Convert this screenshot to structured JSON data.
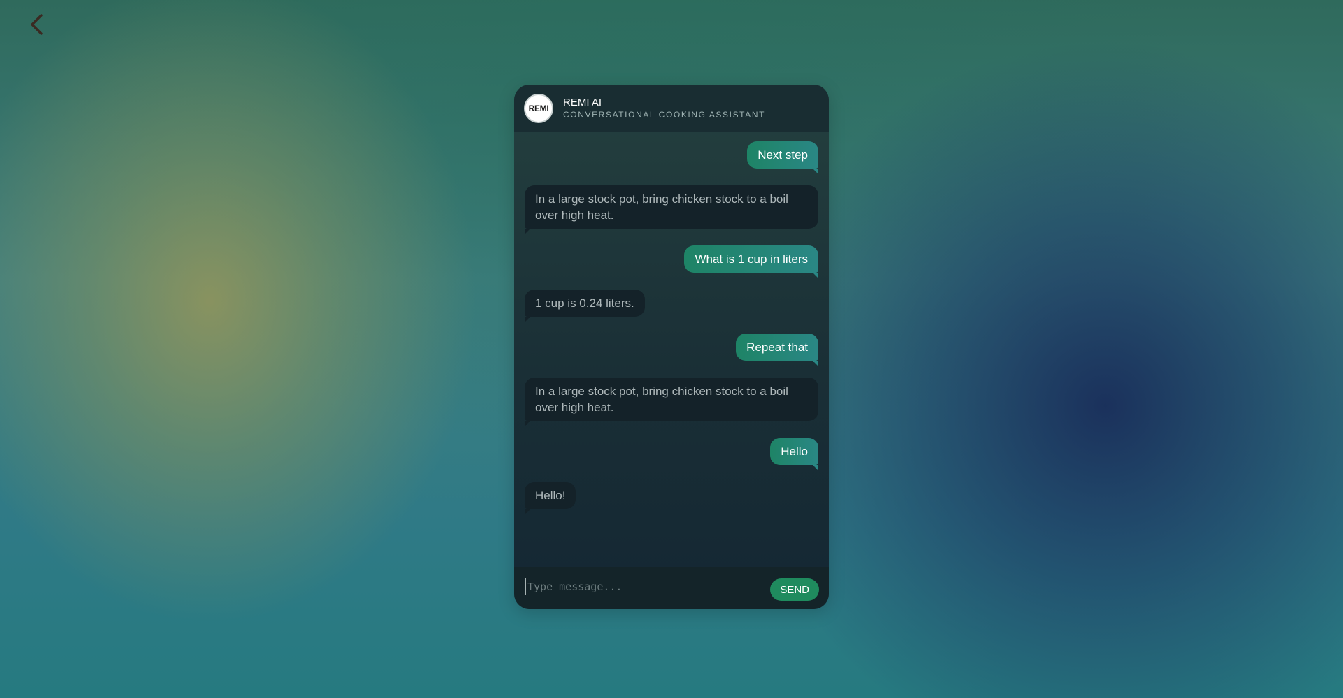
{
  "nav": {
    "back_icon": "chevron-left-icon"
  },
  "header": {
    "avatar_text": "REMI",
    "title": "REMI AI",
    "subtitle": "CONVERSATIONAL COOKING ASSISTANT"
  },
  "messages": [
    {
      "role": "user",
      "text": "Next step"
    },
    {
      "role": "bot",
      "text": "In a large stock pot, bring chicken stock to a boil over high heat."
    },
    {
      "role": "user",
      "text": "What is 1 cup in liters"
    },
    {
      "role": "bot",
      "text": "1 cup is 0.24 liters."
    },
    {
      "role": "user",
      "text": "Repeat that"
    },
    {
      "role": "bot",
      "text": "In a large stock pot, bring chicken stock to a boil over high heat."
    },
    {
      "role": "user",
      "text": "Hello"
    },
    {
      "role": "bot",
      "text": "Hello!"
    }
  ],
  "composer": {
    "placeholder": "Type message...",
    "value": "",
    "send_label": "SEND"
  },
  "colors": {
    "user_bubble": "#1e8466",
    "bot_bubble": "#142229",
    "send_button": "#1f8b5e"
  }
}
